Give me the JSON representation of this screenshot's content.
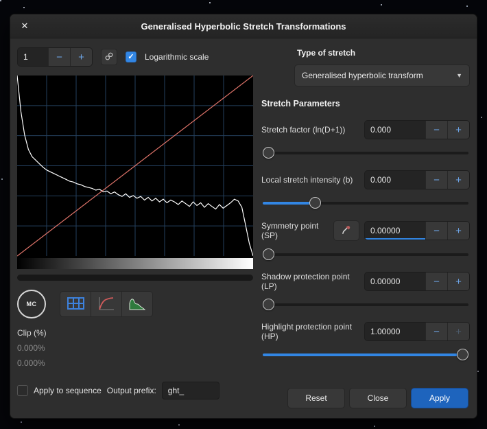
{
  "window": {
    "title": "Generalised Hyperbolic Stretch Transformations",
    "close_icon": "✕"
  },
  "icons": {
    "minus": "−",
    "plus": "+",
    "check": "✓",
    "dropdown_arrow": "▼"
  },
  "topbar": {
    "channel_value": "1",
    "log_scale_label": "Logarithmic scale",
    "log_scale_checked": true
  },
  "type_of_stretch": {
    "label": "Type of stretch",
    "selected_option": "Generalised hyperbolic transform"
  },
  "histogram": {
    "grid_cols": 8,
    "grid_rows": 6,
    "colors": {
      "bg": "#000000",
      "grid": "#24405e",
      "curve": "#ffffff",
      "diagonal": "#e0746a"
    },
    "values": [
      1.0,
      0.8,
      0.67,
      0.59,
      0.55,
      0.53,
      0.51,
      0.49,
      0.475,
      0.465,
      0.455,
      0.445,
      0.435,
      0.425,
      0.415,
      0.41,
      0.4,
      0.395,
      0.385,
      0.38,
      0.375,
      0.365,
      0.37,
      0.355,
      0.36,
      0.345,
      0.355,
      0.34,
      0.33,
      0.345,
      0.325,
      0.335,
      0.32,
      0.33,
      0.31,
      0.325,
      0.305,
      0.32,
      0.3,
      0.315,
      0.295,
      0.31,
      0.3,
      0.285,
      0.305,
      0.29,
      0.275,
      0.3,
      0.28,
      0.295,
      0.27,
      0.29,
      0.275,
      0.26,
      0.285,
      0.265,
      0.28,
      0.295,
      0.315,
      0.305,
      0.27,
      0.17,
      0.07,
      0.0
    ]
  },
  "tools": {
    "mc_label": "MC"
  },
  "clip": {
    "label": "Clip (%)",
    "values": [
      "0.000%",
      "0.000%"
    ]
  },
  "sequence": {
    "checkbox_label": "Apply to sequence",
    "checked": false,
    "prefix_label": "Output prefix:",
    "prefix_value": "ght_"
  },
  "params": {
    "heading": "Stretch Parameters",
    "rows": [
      {
        "label": "Stretch factor (ln(D+1))",
        "value": "0.000",
        "slider_fraction": 0.0,
        "plus_disabled": false,
        "focused": false
      },
      {
        "label": "Local stretch intensity (b)",
        "value": "0.000",
        "slider_fraction": 0.24,
        "plus_disabled": false,
        "focused": false
      },
      {
        "label": "Symmetry point (SP)",
        "value": "0.00000",
        "slider_fraction": 0.0,
        "plus_disabled": false,
        "focused": true
      },
      {
        "label": "Shadow protection point (LP)",
        "value": "0.00000",
        "slider_fraction": 0.0,
        "plus_disabled": false,
        "focused": false
      },
      {
        "label": "Highlight protection point (HP)",
        "value": "1.00000",
        "slider_fraction": 1.0,
        "plus_disabled": true,
        "focused": false
      }
    ]
  },
  "actions": {
    "reset": "Reset",
    "close": "Close",
    "apply": "Apply"
  },
  "colors": {
    "accent": "#3286e4",
    "apply_bg": "#1e64bd"
  }
}
